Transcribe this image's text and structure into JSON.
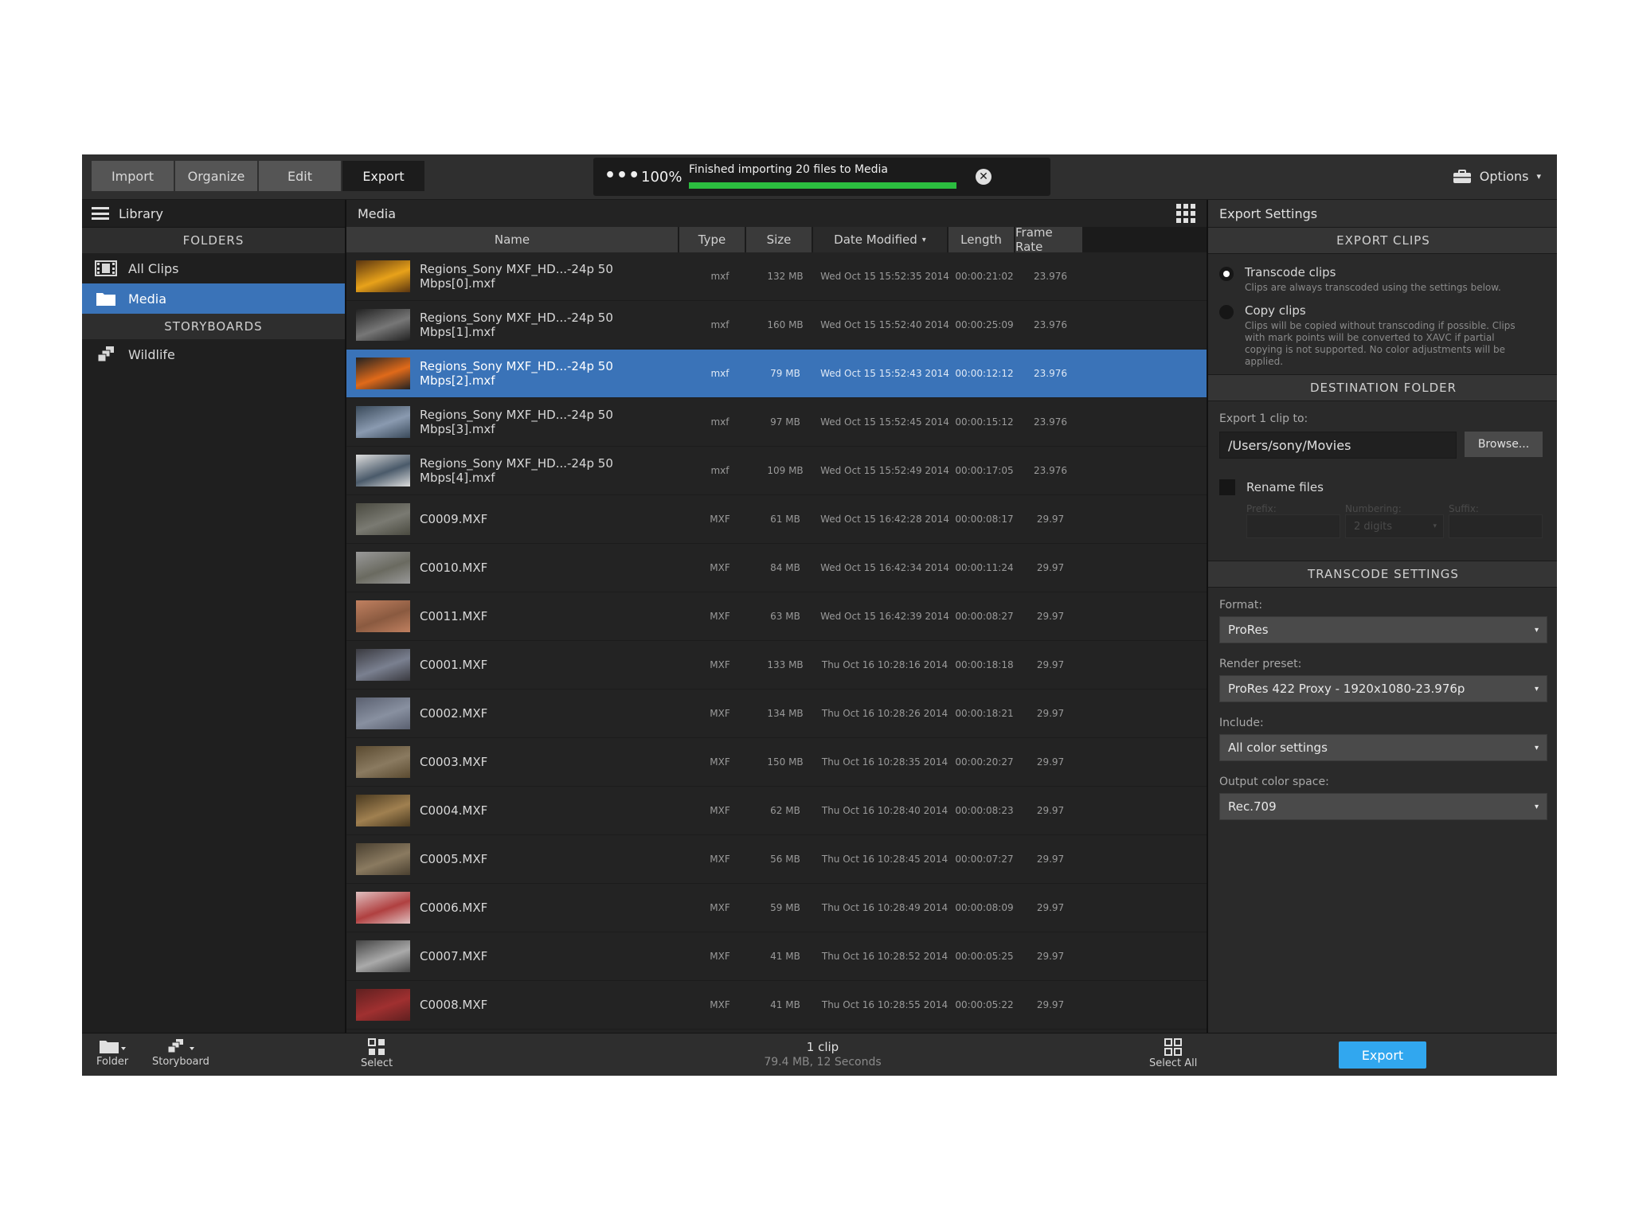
{
  "tabs": [
    {
      "label": "Import"
    },
    {
      "label": "Organize"
    },
    {
      "label": "Edit"
    },
    {
      "label": "Export"
    }
  ],
  "progress": {
    "percent_label": "100%",
    "message": "Finished importing 20 files to Media",
    "fraction": 1.0
  },
  "options_label": "Options",
  "library": {
    "title": "Library",
    "folders_heading": "FOLDERS",
    "folders": [
      {
        "label": "All Clips",
        "icon": "film-icon"
      },
      {
        "label": "Media",
        "icon": "folder-icon"
      }
    ],
    "storyboards_heading": "STORYBOARDS",
    "storyboards": [
      {
        "label": "Wildlife",
        "icon": "storyboard-icon"
      }
    ]
  },
  "media": {
    "title": "Media",
    "columns": [
      "Name",
      "Type",
      "Size",
      "Date Modified",
      "Length",
      "Frame Rate"
    ],
    "rows": [
      {
        "name": "Regions_Sony MXF_HD...-24p 50 Mbps[0].mxf",
        "type": "mxf",
        "size": "132 MB",
        "date": "Wed Oct 15 15:52:35 2014",
        "length": "00:00:21:02",
        "rate": "23.976"
      },
      {
        "name": "Regions_Sony MXF_HD...-24p 50 Mbps[1].mxf",
        "type": "mxf",
        "size": "160 MB",
        "date": "Wed Oct 15 15:52:40 2014",
        "length": "00:00:25:09",
        "rate": "23.976"
      },
      {
        "name": "Regions_Sony MXF_HD...-24p 50 Mbps[2].mxf",
        "type": "mxf",
        "size": "79 MB",
        "date": "Wed Oct 15 15:52:43 2014",
        "length": "00:00:12:12",
        "rate": "23.976"
      },
      {
        "name": "Regions_Sony MXF_HD...-24p 50 Mbps[3].mxf",
        "type": "mxf",
        "size": "97 MB",
        "date": "Wed Oct 15 15:52:45 2014",
        "length": "00:00:15:12",
        "rate": "23.976"
      },
      {
        "name": "Regions_Sony MXF_HD...-24p 50 Mbps[4].mxf",
        "type": "mxf",
        "size": "109 MB",
        "date": "Wed Oct 15 15:52:49 2014",
        "length": "00:00:17:05",
        "rate": "23.976"
      },
      {
        "name": "C0009.MXF",
        "type": "MXF",
        "size": "61 MB",
        "date": "Wed Oct 15 16:42:28 2014",
        "length": "00:00:08:17",
        "rate": "29.97"
      },
      {
        "name": "C0010.MXF",
        "type": "MXF",
        "size": "84 MB",
        "date": "Wed Oct 15 16:42:34 2014",
        "length": "00:00:11:24",
        "rate": "29.97"
      },
      {
        "name": "C0011.MXF",
        "type": "MXF",
        "size": "63 MB",
        "date": "Wed Oct 15 16:42:39 2014",
        "length": "00:00:08:27",
        "rate": "29.97"
      },
      {
        "name": "C0001.MXF",
        "type": "MXF",
        "size": "133 MB",
        "date": "Thu Oct 16 10:28:16 2014",
        "length": "00:00:18:18",
        "rate": "29.97"
      },
      {
        "name": "C0002.MXF",
        "type": "MXF",
        "size": "134 MB",
        "date": "Thu Oct 16 10:28:26 2014",
        "length": "00:00:18:21",
        "rate": "29.97"
      },
      {
        "name": "C0003.MXF",
        "type": "MXF",
        "size": "150 MB",
        "date": "Thu Oct 16 10:28:35 2014",
        "length": "00:00:20:27",
        "rate": "29.97"
      },
      {
        "name": "C0004.MXF",
        "type": "MXF",
        "size": "62 MB",
        "date": "Thu Oct 16 10:28:40 2014",
        "length": "00:00:08:23",
        "rate": "29.97"
      },
      {
        "name": "C0005.MXF",
        "type": "MXF",
        "size": "56 MB",
        "date": "Thu Oct 16 10:28:45 2014",
        "length": "00:00:07:27",
        "rate": "29.97"
      },
      {
        "name": "C0006.MXF",
        "type": "MXF",
        "size": "59 MB",
        "date": "Thu Oct 16 10:28:49 2014",
        "length": "00:00:08:09",
        "rate": "29.97"
      },
      {
        "name": "C0007.MXF",
        "type": "MXF",
        "size": "41 MB",
        "date": "Thu Oct 16 10:28:52 2014",
        "length": "00:00:05:25",
        "rate": "29.97"
      },
      {
        "name": "C0008.MXF",
        "type": "MXF",
        "size": "41 MB",
        "date": "Thu Oct 16 10:28:55 2014",
        "length": "00:00:05:22",
        "rate": "29.97"
      }
    ]
  },
  "export_settings": {
    "title": "Export Settings",
    "export_clips_heading": "EXPORT CLIPS",
    "transcode_label": "Transcode clips",
    "transcode_desc": "Clips are always transcoded using the settings below.",
    "copy_label": "Copy clips",
    "copy_desc": "Clips will be copied without transcoding if possible. Clips with mark points will be converted to XAVC if partial copying is not supported. No color adjustments will be applied.",
    "destination_heading": "DESTINATION FOLDER",
    "export_to_label": "Export 1 clip to:",
    "path": "/Users/sony/Movies",
    "browse_label": "Browse...",
    "rename_label": "Rename files",
    "prefix_label": "Prefix:",
    "numbering_label": "Numbering:",
    "numbering_value": "2 digits",
    "suffix_label": "Suffix:",
    "transcode_heading": "TRANSCODE SETTINGS",
    "format_label": "Format:",
    "format_value": "ProRes",
    "preset_label": "Render preset:",
    "preset_value": "ProRes 422 Proxy - 1920x1080-23.976p",
    "include_label": "Include:",
    "include_value": "All color settings",
    "colorspace_label": "Output color space:",
    "colorspace_value": "Rec.709"
  },
  "bottom": {
    "folder_label": "Folder",
    "storyboard_label": "Storyboard",
    "select_label": "Select",
    "clip_count": "1 clip",
    "clip_meta": "79.4 MB, 12 Seconds",
    "select_all_label": "Select All",
    "export_label": "Export"
  },
  "colors": {
    "selection": "#3a73b8",
    "progress": "#2bbd3f",
    "export_button": "#31a7ef"
  }
}
